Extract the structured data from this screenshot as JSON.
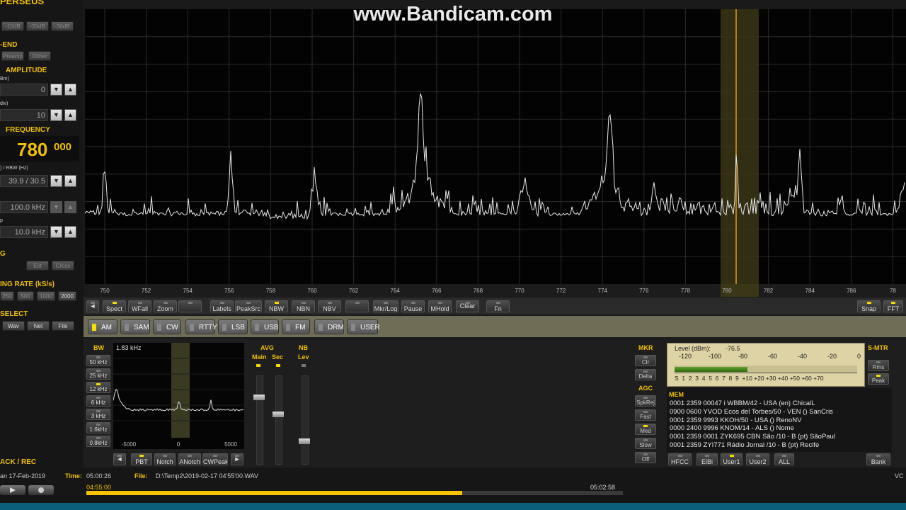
{
  "app": {
    "title": "PERSEUS"
  },
  "watermark": "www.Bandicam.com",
  "left_panel": {
    "att_buttons": [
      "-10dB",
      "-20dB",
      "-30dB"
    ],
    "frontend": {
      "header": "-END",
      "buttons": [
        "Preamp",
        "Dither"
      ]
    },
    "amplitude": {
      "header": "AMPLITUDE",
      "ref_label": "Bm)",
      "ref_value": "0",
      "scale_label": "div)",
      "scale_value": "10"
    },
    "frequency": {
      "header": "FREQUENCY",
      "main": "780",
      "sub": "000"
    },
    "rbw": {
      "label": ") / RBW (Hz)",
      "value": "39.9 / 30.5"
    },
    "span": {
      "value": "100.0 kHz"
    },
    "step": {
      "label": "p",
      "value": "10.0 kHz"
    },
    "g": {
      "label": "G",
      "buttons": [
        "Ext",
        "Cross"
      ]
    },
    "sampling": {
      "header": "ING RATE (kS/s)",
      "buttons": [
        "250",
        "500",
        "1000",
        "2000"
      ]
    },
    "select": {
      "header": "SELECT",
      "buttons": [
        "Wav",
        "Net",
        "File"
      ]
    },
    "playback_label": "ACK / REC"
  },
  "spectrum": {
    "freq_ticks": [
      "750",
      "752",
      "754",
      "756",
      "758",
      "760",
      "762",
      "764",
      "766",
      "768",
      "770",
      "772",
      "774",
      "776",
      "778",
      "780",
      "782",
      "784",
      "786",
      "78"
    ],
    "colors": {
      "trace": "#e8e8e8",
      "marker": "#e09a20",
      "highlight": "#3a3618",
      "grid": "#2b2b2b"
    }
  },
  "toolbar": {
    "buttons": [
      {
        "label": "◄",
        "led": false
      },
      {
        "label": "Spect",
        "led": true
      },
      {
        "label": "WFall",
        "led": false
      },
      {
        "label": "Zoom",
        "led": false
      },
      {
        "label": "",
        "led": false
      },
      {
        "label": "Labels",
        "led": false
      },
      {
        "label": "PeakSrc",
        "led": false
      },
      {
        "label": "NBW",
        "led": true
      },
      {
        "label": "NBN",
        "led": false
      },
      {
        "label": "NBV",
        "led": false
      },
      {
        "label": "",
        "led": false
      },
      {
        "label": "Mkr/Log",
        "led": false
      },
      {
        "label": "Pause",
        "led": false
      },
      {
        "label": "MHold",
        "led": false
      },
      {
        "label": "Clear",
        "led": false
      },
      {
        "label": "Fn",
        "led": false
      },
      {
        "label": "Snap",
        "led": true
      },
      {
        "label": "FFT",
        "led": true
      }
    ]
  },
  "modes": [
    {
      "label": "AM",
      "active": true
    },
    {
      "label": "SAM",
      "active": false
    },
    {
      "label": "CW",
      "active": false
    },
    {
      "label": "RTTY",
      "active": false
    },
    {
      "label": "LSB",
      "active": false
    },
    {
      "label": "USB",
      "active": false
    },
    {
      "label": "FM",
      "active": false
    },
    {
      "label": "DRM",
      "active": false
    },
    {
      "label": "USER",
      "active": false
    }
  ],
  "bw": {
    "header": "BW",
    "readout": "1.83 kHz",
    "buttons": [
      {
        "label": "50 kHz",
        "led": false
      },
      {
        "label": "25 kHz",
        "led": false
      },
      {
        "label": "12 kHz",
        "led": true
      },
      {
        "label": "6 kHz",
        "led": false
      },
      {
        "label": "3 kHz",
        "led": false
      },
      {
        "label": "1.6kHz",
        "led": false
      },
      {
        "label": "0.8kHz",
        "led": false
      }
    ],
    "axis_ticks": [
      "-5000",
      "0",
      "5000"
    ],
    "bottom_buttons": [
      {
        "label": "◄",
        "led": false
      },
      {
        "label": "PBT",
        "led": true
      },
      {
        "label": "Notch",
        "led": false
      },
      {
        "label": "ANotch",
        "led": false
      },
      {
        "label": "CWPeak",
        "led": false
      },
      {
        "label": "►",
        "led": false
      }
    ]
  },
  "avg": {
    "header": "AVG",
    "main_label": "Main",
    "sec_label": "Sec",
    "main_level": 0.77,
    "sec_level": 0.56
  },
  "nb": {
    "header": "NB",
    "lev_label": "Lev",
    "level": 0.23
  },
  "mkr": {
    "header": "MKR",
    "buttons": [
      "Clr",
      "Delta"
    ]
  },
  "agc": {
    "header": "AGC",
    "buttons": [
      {
        "label": "SpkRej",
        "led": false
      },
      {
        "label": "Fast",
        "led": false
      },
      {
        "label": "Med",
        "led": true
      },
      {
        "label": "Slow",
        "led": false
      },
      {
        "label": "Off",
        "led": false
      }
    ]
  },
  "smeter": {
    "header": "S-MTR",
    "level_label": "Level (dBm):",
    "level_value": "-76.5",
    "dbm_scale": [
      "-120",
      "-100",
      "-80",
      "-60",
      "-40",
      "-20",
      "0"
    ],
    "s_scale": "S  1  2  3  4  5  6  7  8  9  +10 +20 +30 +40 +50 +60 +70",
    "bar_fraction": 0.4,
    "buttons": [
      {
        "label": "Rms",
        "led": false
      },
      {
        "label": "Peak",
        "led": true
      }
    ]
  },
  "mem": {
    "header": "MEM",
    "rows": [
      "0001 2359 00047 i WBBM/42  - USA (en)  ChicalL",
      "0900 0600 YVOD Ecos del Torbes/50  - VEN ()  SanCris",
      "0001 2359 9993 KKOH/50  - USA ()  RenoNV",
      "0000 2400 9996 KNOM/14  - ALS ()  Nome",
      "0001 2359 0001 ZYK695 CBN São /10  - B (pt)  SãoPaul",
      "0001 2359 ZYI771 Rádio Jornal /10  - B (pt)  Recife"
    ],
    "buttons": [
      {
        "label": "HFCC",
        "led": false
      },
      {
        "label": "EiBi",
        "led": false
      },
      {
        "label": "User1",
        "led": true
      },
      {
        "label": "User2",
        "led": false
      },
      {
        "label": "ALL",
        "led": false
      },
      {
        "label": "Bank",
        "led": false
      }
    ]
  },
  "status": {
    "date": "an 17-Feb-2019",
    "time_label": "Time:",
    "time_value": "05:00:26",
    "file_label": "File:",
    "file_value": "D:\\Temp2\\2019-02-17 04'55'00.WAV",
    "start_time": "04:55:00",
    "end_time": "05:02:58",
    "progress": 0.7,
    "vc": "VC"
  }
}
